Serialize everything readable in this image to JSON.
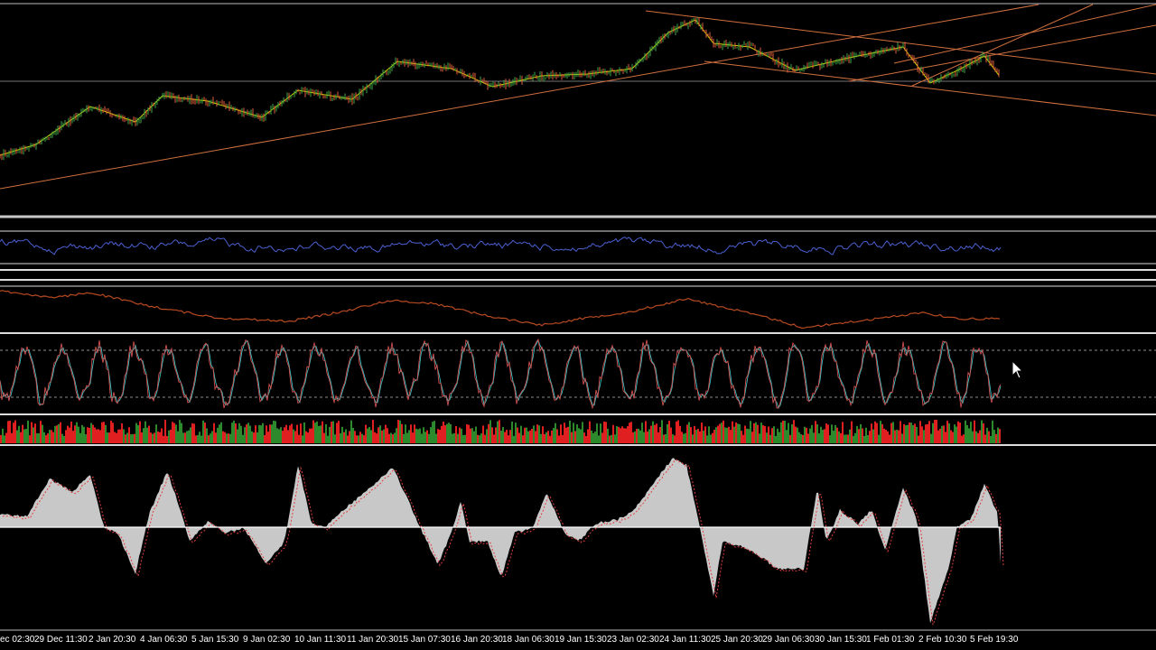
{
  "chart": {
    "app": "trading-chart",
    "colors": {
      "background": "#000000",
      "separator": "#c8c8c8",
      "candle_up": "#3fa84a",
      "candle_down": "#e0603a",
      "ma_line": "#d6d600",
      "trendline": "#d07040",
      "rsi_line": "#4a5fd0",
      "slow_line": "#b84a22",
      "stoch_main": "#d05050",
      "stoch_signal": "#40c0c0",
      "volume_up": "#2c8a2c",
      "volume_down": "#e02020",
      "histogram_fill": "#c8c8c8",
      "signal_dotted": "#e04040",
      "axis_text": "#ffffff"
    },
    "time_axis": {
      "labels": [
        "ec 02:30",
        "29 Dec 11:30",
        "2 Jan 20:30",
        "4 Jan 06:30",
        "5 Jan 15:30",
        "9 Jan 02:30",
        "10 Jan 11:30",
        "11 Jan 20:30",
        "15 Jan 07:30",
        "16 Jan 20:30",
        "18 Jan 06:30",
        "19 Jan 15:30",
        "23 Jan 02:30",
        "24 Jan 11:30",
        "25 Jan 20:30",
        "29 Jan 06:30",
        "30 Jan 15:30",
        "1 Feb 01:30",
        "2 Feb 10:30",
        "5 Feb 19:30"
      ]
    },
    "panes": [
      {
        "name": "price-pane",
        "icon": "candlestick-chart-icon"
      },
      {
        "name": "rsi-pane",
        "icon": "oscillator-icon"
      },
      {
        "name": "trend-pane",
        "icon": "line-indicator-icon"
      },
      {
        "name": "stochastic-pane",
        "icon": "oscillator-icon"
      },
      {
        "name": "volume-pane",
        "icon": "volume-bars-icon"
      },
      {
        "name": "histogram-pane",
        "icon": "histogram-icon"
      }
    ],
    "cursor": "arrow-pointer"
  }
}
